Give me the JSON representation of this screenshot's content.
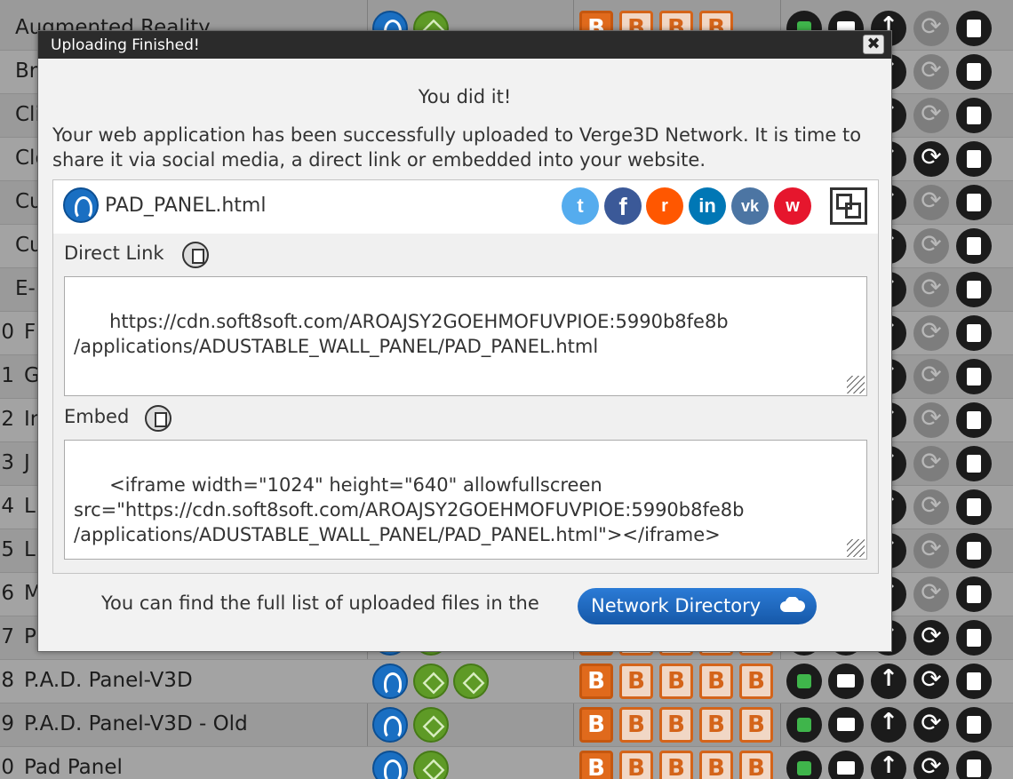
{
  "background": {
    "rows": [
      {
        "num": "",
        "name": "Augmented Reality",
        "partial": true
      },
      {
        "num": "",
        "name": "Br"
      },
      {
        "num": "",
        "name": "Cli"
      },
      {
        "num": "",
        "name": "Clo"
      },
      {
        "num": "",
        "name": "Cu"
      },
      {
        "num": "",
        "name": "Cu"
      },
      {
        "num": "",
        "name": "E-"
      },
      {
        "num": "0",
        "name": "F"
      },
      {
        "num": "1",
        "name": "Gl"
      },
      {
        "num": "2",
        "name": "In"
      },
      {
        "num": "3",
        "name": "J"
      },
      {
        "num": "4",
        "name": "L"
      },
      {
        "num": "5",
        "name": "L"
      },
      {
        "num": "6",
        "name": "M"
      },
      {
        "num": "7",
        "name": "P"
      },
      {
        "num": "8",
        "name": "P.A.D. Panel-V3D"
      },
      {
        "num": "9",
        "name": "P.A.D. Panel-V3D - Old"
      },
      {
        "num": "0",
        "name": "Pad Panel"
      }
    ],
    "b_label": "B"
  },
  "modal": {
    "title": "Uploading Finished!",
    "close_label": "✖",
    "heading": "You did it!",
    "description": "Your web application has been successfully uploaded to Verge3D Network. It is time to share it via social media, a direct link or embedded into your website.",
    "app_name": "PAD_PANEL.html",
    "social": {
      "twitter": "t",
      "facebook": "f",
      "reddit": "r",
      "linkedin": "in",
      "vk": "vk",
      "weibo": "w"
    },
    "direct_link_label": "Direct Link",
    "direct_link_value": "https://cdn.soft8soft.com/AROAJSY2GOEHMOFUVPIOE:5990b8fe8b\n/applications/ADUSTABLE_WALL_PANEL/PAD_PANEL.html",
    "embed_label": "Embed",
    "embed_value": "<iframe width=\"1024\" height=\"640\" allowfullscreen\nsrc=\"https://cdn.soft8soft.com/AROAJSY2GOEHMOFUVPIOE:5990b8fe8b\n/applications/ADUSTABLE_WALL_PANEL/PAD_PANEL.html\"></iframe>",
    "footer_text": "You can find the full list of uploaded files in the",
    "network_button": "Network Directory"
  }
}
